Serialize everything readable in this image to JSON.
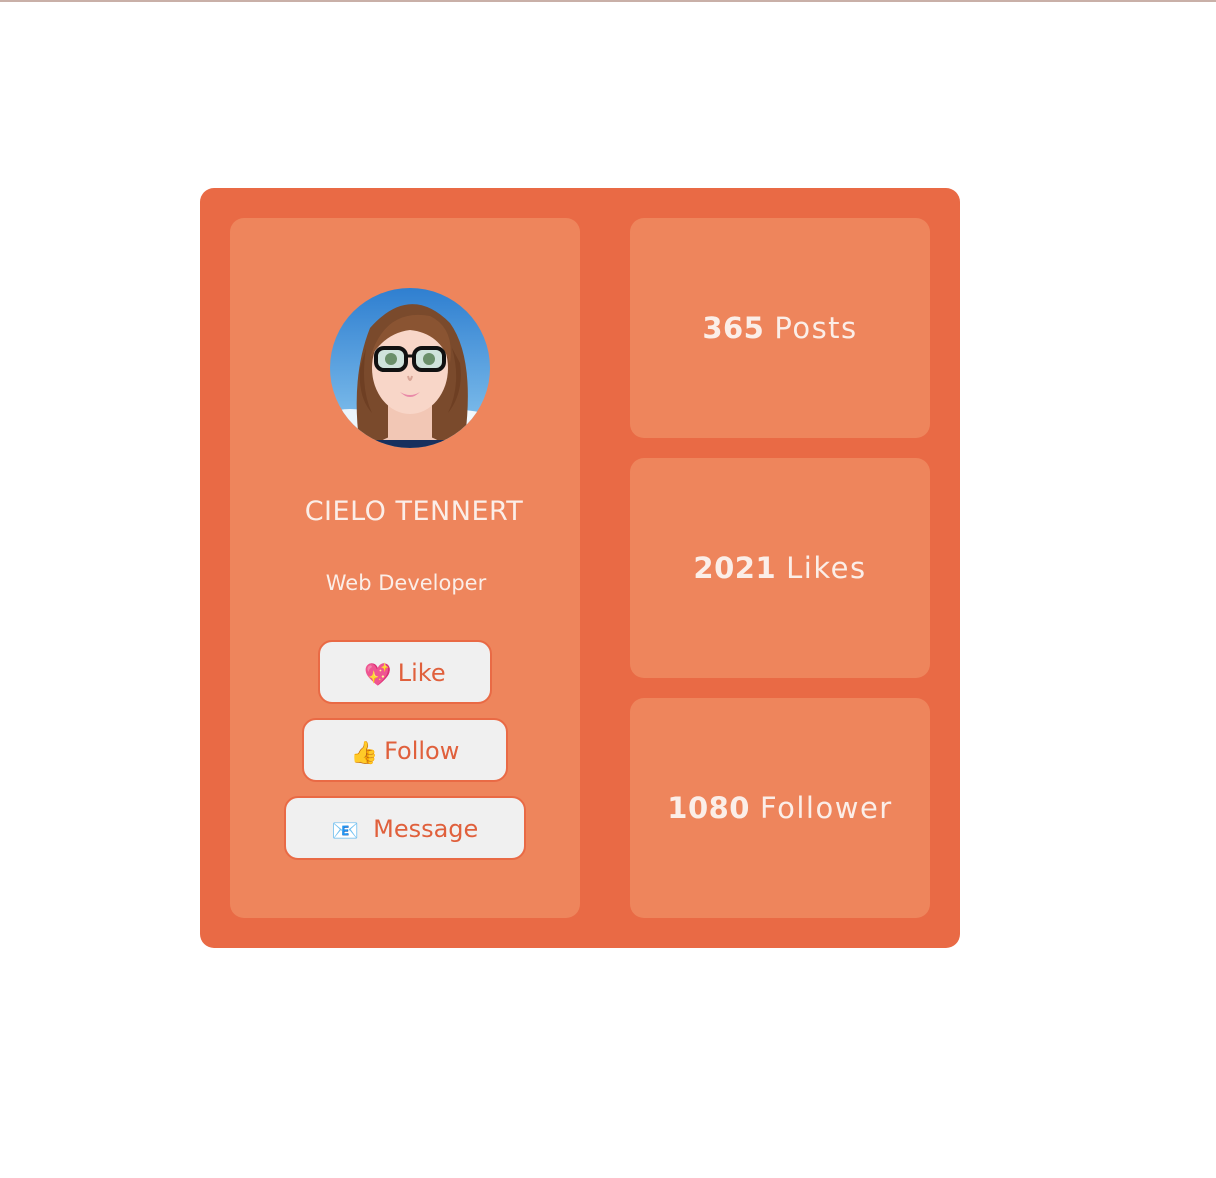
{
  "profile": {
    "name": "CIELO TENNERT",
    "role": "Web Developer",
    "avatar_alt": "avatar"
  },
  "actions": {
    "like": {
      "icon": "sparkling-heart-icon",
      "emoji": "💖",
      "label": "Like"
    },
    "follow": {
      "icon": "thumbs-up-icon",
      "emoji": "👍",
      "label": "Follow"
    },
    "message": {
      "icon": "envelope-icon",
      "emoji": "📧",
      "label": "Message"
    }
  },
  "stats": {
    "posts": {
      "value": "365",
      "label": "Posts"
    },
    "likes": {
      "value": "2021",
      "label": "Likes"
    },
    "followers": {
      "value": "1080",
      "label": "Follower"
    }
  },
  "colors": {
    "card": "#e96a45",
    "panel": "#ee855c",
    "button_bg": "#f0f0f0",
    "button_text": "#e0603c",
    "text_light": "#fbeee8"
  }
}
